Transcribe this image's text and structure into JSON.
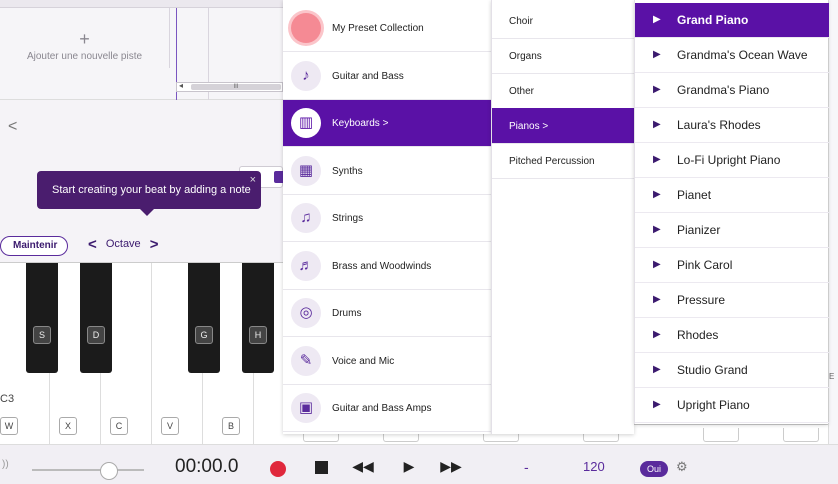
{
  "track_area": {
    "add_track_plus": "+",
    "add_track_label": "Ajouter une nouvelle piste",
    "scroll_arrow": "◂",
    "scroll_thumb": "III"
  },
  "piano_view": {
    "back_chevron": "<",
    "tooltip_text": "Start creating your beat by adding a note",
    "tooltip_close": "×",
    "sustain_label": "Maintenir",
    "octave_prev": "<",
    "octave_label": "Octave",
    "octave_next": ">",
    "octave_marker": "C3",
    "black_keys": [
      "S",
      "D",
      "G",
      "H"
    ],
    "white_keys": [
      "W",
      "X",
      "C",
      "V",
      "B"
    ]
  },
  "transport": {
    "volume_icon": "))",
    "time": "00:00.0",
    "rewind": "◀◀",
    "play": "▶",
    "forward": "▶▶",
    "key_value": "-",
    "tempo": "120",
    "metronome_toggle": "Oui",
    "settings_icon": "⚙"
  },
  "right_strip_label": "E",
  "categories": [
    {
      "label": "My Preset Collection",
      "icon": "preset-collection-icon",
      "glyph": "●",
      "selected": false
    },
    {
      "label": "Guitar and Bass",
      "icon": "guitar-icon",
      "glyph": "♪",
      "selected": false
    },
    {
      "label": "Keyboards  >",
      "icon": "keyboard-icon",
      "glyph": "▥",
      "selected": true
    },
    {
      "label": "Synths",
      "icon": "synth-icon",
      "glyph": "▦",
      "selected": false
    },
    {
      "label": "Strings",
      "icon": "violin-icon",
      "glyph": "♫",
      "selected": false
    },
    {
      "label": "Brass and Woodwinds",
      "icon": "trumpet-icon",
      "glyph": "♬",
      "selected": false
    },
    {
      "label": "Drums",
      "icon": "drum-icon",
      "glyph": "◎",
      "selected": false
    },
    {
      "label": "Voice and Mic",
      "icon": "microphone-icon",
      "glyph": "✎",
      "selected": false
    },
    {
      "label": "Guitar and Bass Amps",
      "icon": "amp-icon",
      "glyph": "▣",
      "selected": false
    }
  ],
  "subcategories": [
    {
      "label": "Choir",
      "selected": false
    },
    {
      "label": "Organs",
      "selected": false
    },
    {
      "label": "Other",
      "selected": false
    },
    {
      "label": "Pianos  >",
      "selected": true
    },
    {
      "label": "Pitched Percussion",
      "selected": false
    }
  ],
  "presets": [
    {
      "label": "Grand Piano",
      "selected": true
    },
    {
      "label": "Grandma's Ocean Wave",
      "selected": false
    },
    {
      "label": "Grandma's Piano",
      "selected": false
    },
    {
      "label": "Laura's Rhodes",
      "selected": false
    },
    {
      "label": "Lo-Fi Upright Piano",
      "selected": false
    },
    {
      "label": "Pianet",
      "selected": false
    },
    {
      "label": "Pianizer",
      "selected": false
    },
    {
      "label": "Pink Carol",
      "selected": false
    },
    {
      "label": "Pressure",
      "selected": false
    },
    {
      "label": "Rhodes",
      "selected": false
    },
    {
      "label": "Studio Grand",
      "selected": false
    },
    {
      "label": "Upright Piano",
      "selected": false
    }
  ],
  "colors": {
    "accent": "#5a11a6",
    "tooltip": "#4a1d6e",
    "record": "#e0283c"
  }
}
